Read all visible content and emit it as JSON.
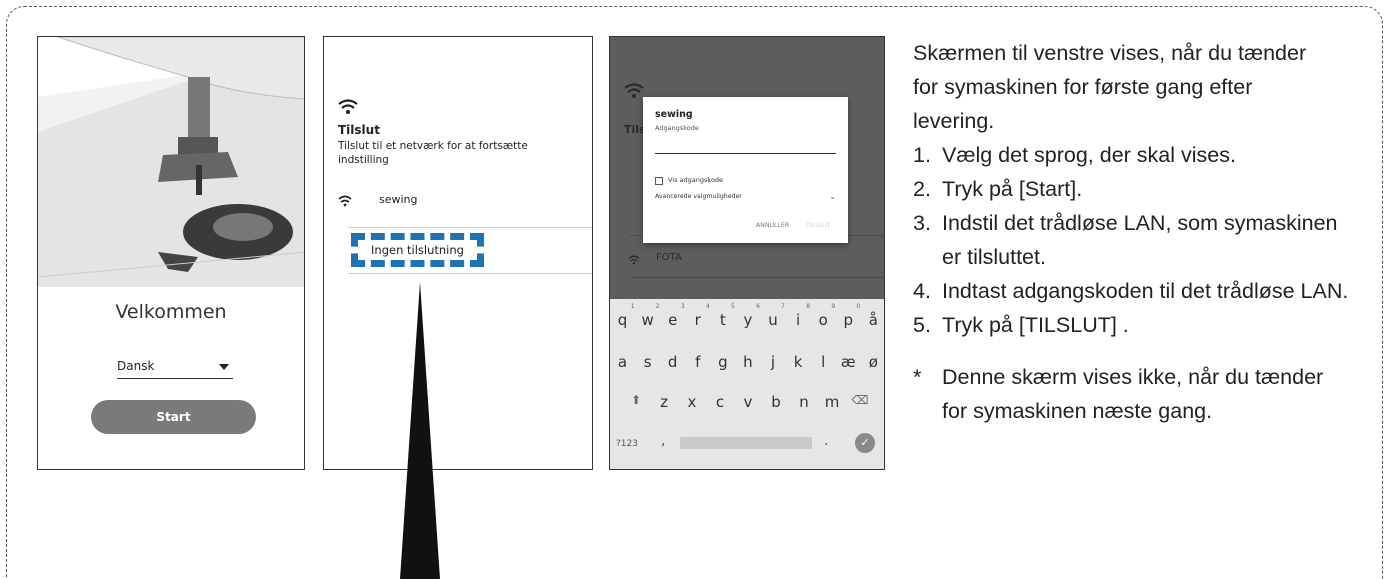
{
  "phone1": {
    "welcome": "Velkommen",
    "language": "Dansk",
    "start_button": "Start"
  },
  "phone2": {
    "title": "Tilslut",
    "description": "Tilslut til et netværk for at fortsætte indstilling",
    "network": "sewing",
    "no_connection": "Ingen tilslutning"
  },
  "phone3": {
    "dialog_title": "sewing",
    "password_label": "Adgangskode",
    "show_password": "Vis adgangskode",
    "advanced_options": "Avancerede valgmuligheder",
    "cancel": "ANNULLER",
    "connect": "TILSLUT",
    "network_fota": "FOTA",
    "bg_title_fragment": "Tils",
    "keyboard": {
      "row1": [
        "q",
        "w",
        "e",
        "r",
        "t",
        "y",
        "u",
        "i",
        "o",
        "p",
        "å"
      ],
      "row1_digits": [
        "1",
        "2",
        "3",
        "4",
        "5",
        "6",
        "7",
        "8",
        "9",
        "0",
        ""
      ],
      "row2": [
        "a",
        "s",
        "d",
        "f",
        "g",
        "h",
        "j",
        "k",
        "l",
        "æ",
        "ø"
      ],
      "row3": [
        "z",
        "x",
        "c",
        "v",
        "b",
        "n",
        "m"
      ],
      "symbols_key": "?123",
      "comma_key": ",",
      "period_key": "."
    }
  },
  "instructions": {
    "intro": "Skærmen til venstre vises, når du tænder for symaskinen for første gang efter levering.",
    "steps": [
      {
        "num": "1.",
        "text": "Vælg det sprog, der skal vises."
      },
      {
        "num": "2.",
        "text": "Tryk på [Start]."
      },
      {
        "num": "3.",
        "text": "Indstil det trådløse LAN, som symaskinen er tilsluttet."
      },
      {
        "num": "4.",
        "text": "Indtast adgangskoden til det trådløse LAN."
      },
      {
        "num": "5.",
        "text": "Tryk på [TILSLUT] ."
      }
    ],
    "note_marker": "*",
    "note": "Denne skærm vises ikke, når du tænder for symaskinen næste gang."
  },
  "colors": {
    "highlight_dash": "#1f73b5",
    "start_button_bg": "#7a7a7a",
    "dim_overlay": "#5d5d5d"
  }
}
